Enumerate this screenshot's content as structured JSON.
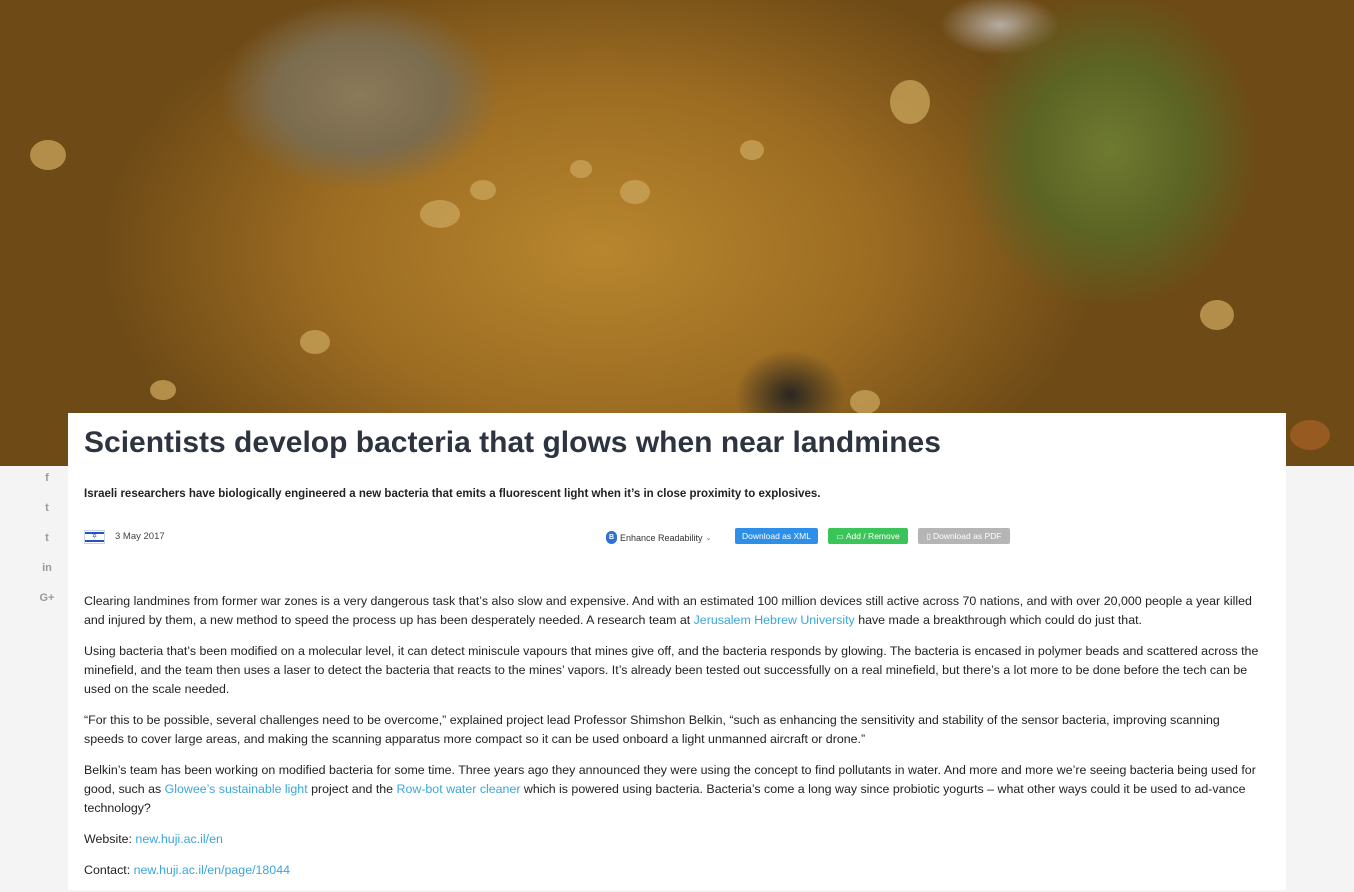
{
  "article": {
    "title": "Scientists develop bacteria that glows when near landmines",
    "subtitle": "Israeli researchers have biologically engineered a new bacteria that emits a fluorescent light when it’s in close proximity to explosives.",
    "date": "3 May 2017",
    "flag_icon": "israel-flag-icon",
    "paragraphs": {
      "p1": {
        "before": "Clearing landmines from former war zones is a very dangerous task that’s also slow and expensive. And with an estimated 100 million devices still active across 70 nations, and with over 20,000 people a year killed and injured by them, a new method to speed the process up has been desperately needed. A research team at ",
        "link": "Jerusalem Hebrew University",
        "after": " have made a breakthrough which could do just that."
      },
      "p2": "Using bacteria that’s been modified on a molecular level, it can detect miniscule vapours that mines give off, and the bacteria responds by glowing. The bacteria is encased in polymer beads and scattered across the minefield, and the team then uses a laser to detect the bacteria that reacts to the mines’ vapors. It’s already been tested out successfully on a real minefield, but there’s a lot more to be done before the tech can be used on the scale needed.",
      "p3": "“For this to be possible, several challenges need to be overcome,” explained project lead Professor Shimshon Belkin, “such as enhancing the sensitivity and stability of the sensor bacteria, improving scanning speeds to cover large areas, and making the scanning apparatus more compact so it can be used onboard a light unmanned aircraft or drone.”",
      "p4": {
        "before": "Belkin’s team has been working on modified bacteria for some time. Three years ago they announced they were using the concept to find pollutants in water. And more and more we’re seeing bacteria being used for good, such as ",
        "link1": "Glowee’s sustainable light",
        "middle": " project and the ",
        "link2": "Row-bot water cleaner",
        "after": " which is powered using bacteria. Bacteria’s come a long way since probiotic yogurts – what other ways could it be used to ad-vance technology?"
      }
    },
    "website_label": "Website: ",
    "website_link": "new.huji.ac.il/en",
    "contact_label": "Contact: ",
    "contact_link": "new.huji.ac.il/en/page/18044"
  },
  "toolbar": {
    "readability_label": "Enhance Readability",
    "readability_icon": "readability-badge-icon",
    "xml_label": "Download as XML",
    "add_label": "Add / Remove",
    "add_icon": "folder-icon",
    "pdf_label": "Download as PDF",
    "pdf_icon": "document-icon"
  },
  "social": {
    "icons": [
      "facebook-icon",
      "twitter-icon",
      "tumblr-icon",
      "linkedin-icon",
      "google-plus-icon"
    ],
    "glyphs": [
      "f",
      "t",
      "t",
      "in",
      "G+"
    ]
  },
  "colors": {
    "link": "#3aa6d8",
    "xml_button": "#2d8fe8",
    "add_button": "#3bc45a",
    "pdf_button": "#b5b5b5",
    "title": "#2d3440"
  }
}
